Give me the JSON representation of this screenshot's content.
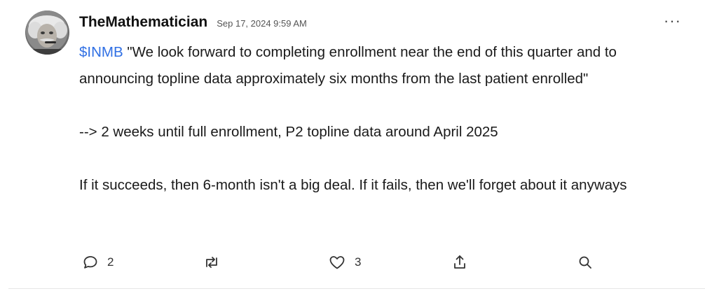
{
  "post": {
    "username": "TheMathematician",
    "timestamp": "Sep 17, 2024 9:59 AM",
    "more_label": "···",
    "ticker": "$INMB",
    "quote_text": " \"We look forward to completing enrollment near the end of this quarter and to announcing topline data approximately six months from the last patient enrolled\"",
    "paragraph_2": "--> 2 weeks until full enrollment, P2 topline data around April 2025",
    "paragraph_3": "If it succeeds, then 6-month isn't a big deal. If it fails, then we'll forget about it anyways"
  },
  "actions": {
    "reply": {
      "icon": "comment-icon",
      "count": "2"
    },
    "reshare": {
      "icon": "repost-icon"
    },
    "like": {
      "icon": "heart-icon",
      "count": "3"
    },
    "share": {
      "icon": "share-icon"
    },
    "search": {
      "icon": "search-icon"
    }
  },
  "colors": {
    "ticker": "#2f6fe4",
    "text": "#1a1a1a",
    "muted": "#555555",
    "divider": "#e6e6e6"
  }
}
